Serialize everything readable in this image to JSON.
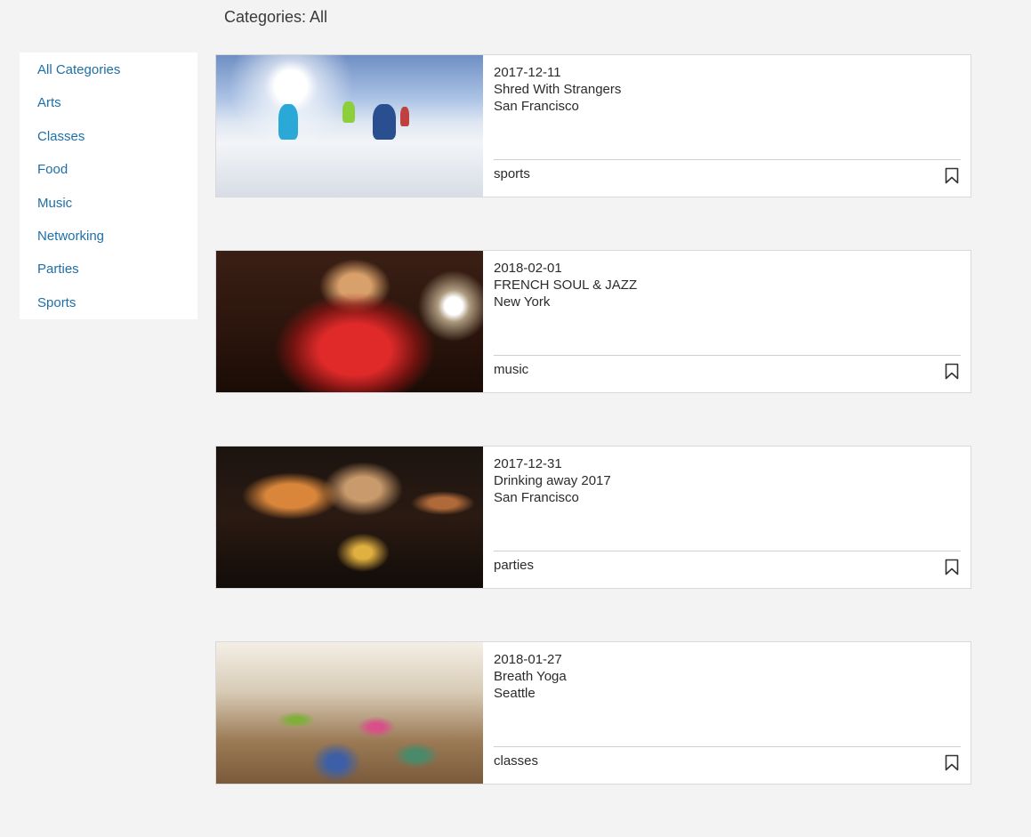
{
  "page": {
    "title": "Categories: All"
  },
  "sidebar": {
    "items": [
      {
        "label": "All Categories"
      },
      {
        "label": "Arts"
      },
      {
        "label": "Classes"
      },
      {
        "label": "Food"
      },
      {
        "label": "Music"
      },
      {
        "label": "Networking"
      },
      {
        "label": "Parties"
      },
      {
        "label": "Sports"
      }
    ]
  },
  "events": [
    {
      "date": "2017-12-11",
      "title": "Shred With Strangers",
      "city": "San Francisco",
      "category": "sports",
      "image": "skiers-photo"
    },
    {
      "date": "2018-02-01",
      "title": "FRENCH SOUL & JAZZ",
      "city": "New York",
      "category": "music",
      "image": "jazz-singer-photo"
    },
    {
      "date": "2017-12-31",
      "title": "Drinking away 2017",
      "city": "San Francisco",
      "category": "parties",
      "image": "party-photo"
    },
    {
      "date": "2018-01-27",
      "title": "Breath Yoga",
      "city": "Seattle",
      "category": "classes",
      "image": "yoga-class-photo"
    }
  ],
  "colors": {
    "background": "#f3f3f3",
    "link": "#1e6fa8",
    "card": "#ffffff",
    "divider": "#cfcfcf"
  },
  "icons": {
    "bookmark": "bookmark-icon"
  }
}
